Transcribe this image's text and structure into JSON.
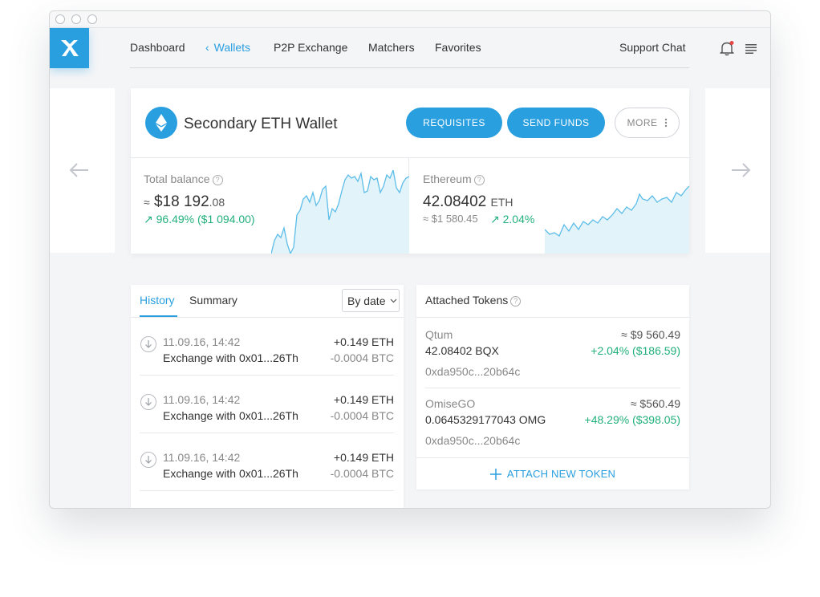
{
  "nav": {
    "items": [
      {
        "label": "Dashboard",
        "active": false
      },
      {
        "label": "Wallets",
        "active": true
      },
      {
        "label": "P2P Exchange",
        "active": false
      },
      {
        "label": "Matchers",
        "active": false
      },
      {
        "label": "Favorites",
        "active": false
      }
    ],
    "support": "Support Chat",
    "notification_dot_color": "#e84545"
  },
  "wallet": {
    "title": "Secondary ETH Wallet",
    "buttons": {
      "requisites": "REQUISITES",
      "send": "SEND FUNDS",
      "more": "MORE"
    },
    "total": {
      "label": "Total balance",
      "approx": "≈",
      "value_main": "$18 192",
      "value_decimals": ".08",
      "change": "↗ 96.49% ($1 094.00)"
    },
    "coin": {
      "label": "Ethereum",
      "value": "42.08402",
      "unit": "ETH",
      "usd": "≈ $1 580.45",
      "change": "↗ 2.04%"
    }
  },
  "history": {
    "tabs": [
      "History",
      "Summary"
    ],
    "sort": "By date",
    "rows": [
      {
        "date": "11.09.16, 14:42",
        "desc": "Exchange with 0x01...26Th",
        "amount": "+0.149 ETH",
        "amount2": "-0.0004 BTC"
      },
      {
        "date": "11.09.16, 14:42",
        "desc": "Exchange with 0x01...26Th",
        "amount": "+0.149 ETH",
        "amount2": "-0.0004 BTC"
      },
      {
        "date": "11.09.16, 14:42",
        "desc": "Exchange with 0x01...26Th",
        "amount": "+0.149 ETH",
        "amount2": "-0.0004 BTC"
      }
    ]
  },
  "tokens": {
    "title": "Attached Tokens",
    "items": [
      {
        "name": "Qtum",
        "amount": "42.08402 BQX",
        "address": "0xda950c...20b64c",
        "usd": "≈ $9 560.49",
        "change": "+2.04% ($186.59)"
      },
      {
        "name": "OmiseGO",
        "amount": "0.0645329177043 OMG",
        "address": "0xda950c...20b64c",
        "usd": "≈ $560.49",
        "change": "+48.29% ($398.05)"
      }
    ],
    "attach": "ATTACH NEW TOKEN"
  },
  "colors": {
    "accent": "#2a9fe0",
    "positive": "#22b07d",
    "chart_fill": "#e3f3fa"
  }
}
